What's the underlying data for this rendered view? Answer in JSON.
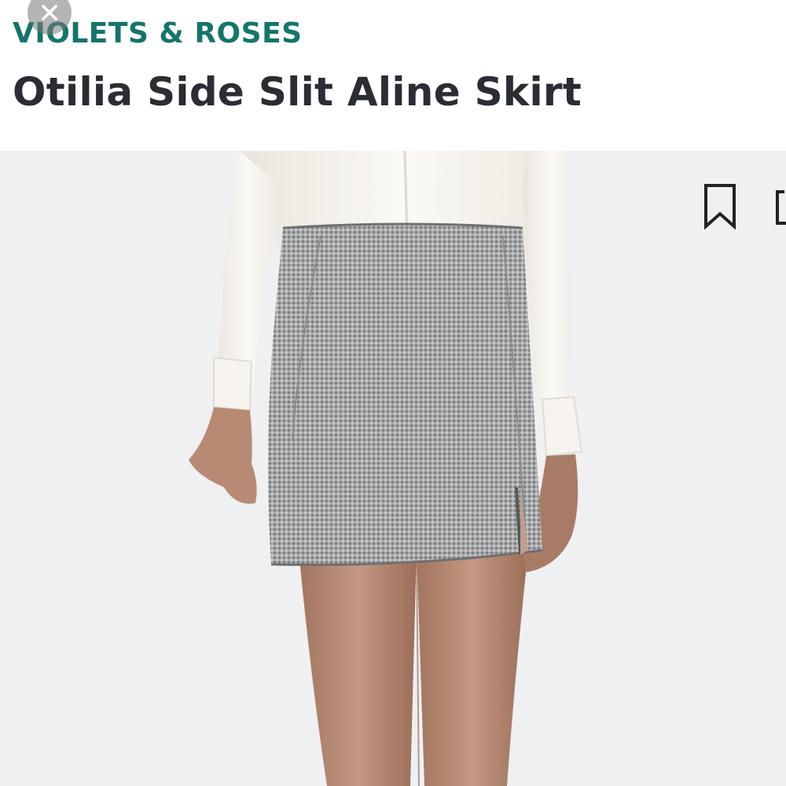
{
  "header": {
    "brand": "VIOLETS & ROSES",
    "title": "Otilia Side Slit Aline Skirt"
  },
  "icons": {
    "close": "close-icon",
    "bookmark": "bookmark-icon",
    "share": "share-icon"
  },
  "colors": {
    "brand": "#14756b",
    "title": "#2a2d33",
    "image_background": "#eef0f2"
  }
}
